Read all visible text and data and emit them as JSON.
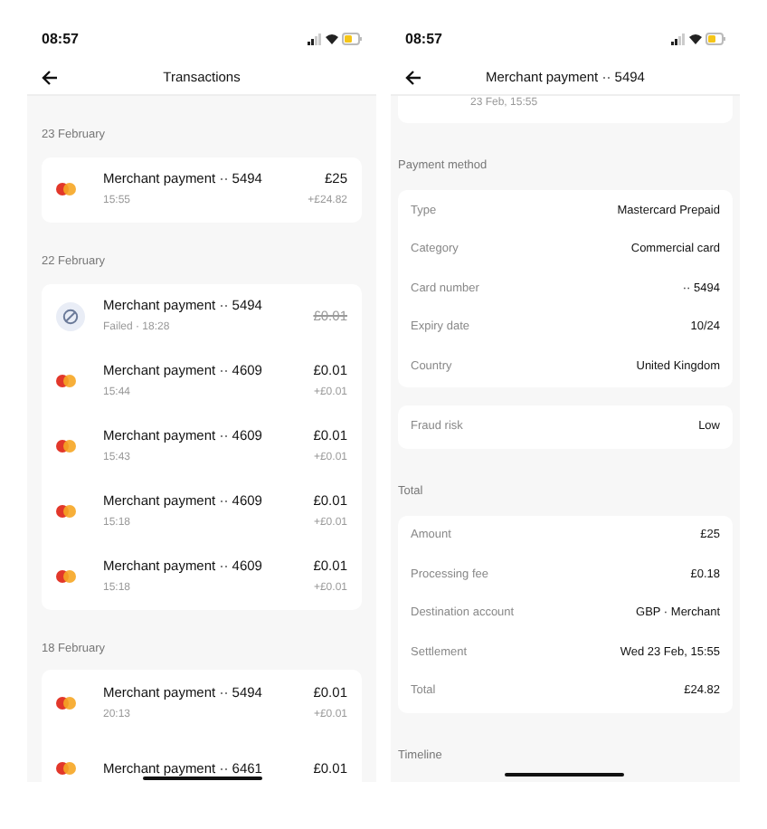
{
  "transactions_screen": {
    "status_bar": {
      "time": "08:57"
    },
    "header": {
      "title": "Transactions"
    },
    "groups": [
      {
        "date": "23 February",
        "rows": [
          {
            "failed": false,
            "title": "Merchant payment ·· 5494",
            "subtitle": "15:55",
            "amount": "£25",
            "net": "+£24.82"
          }
        ]
      },
      {
        "date": "22 February",
        "rows": [
          {
            "failed": true,
            "title": "Merchant payment ·· 5494",
            "subtitle": "Failed · 18:28",
            "amount": "£0.01"
          },
          {
            "failed": false,
            "title": "Merchant payment ·· 4609",
            "subtitle": "15:44",
            "amount": "£0.01",
            "net": "+£0.01"
          },
          {
            "failed": false,
            "title": "Merchant payment ·· 4609",
            "subtitle": "15:43",
            "amount": "£0.01",
            "net": "+£0.01"
          },
          {
            "failed": false,
            "title": "Merchant payment ·· 4609",
            "subtitle": "15:18",
            "amount": "£0.01",
            "net": "+£0.01"
          },
          {
            "failed": false,
            "title": "Merchant payment ·· 4609",
            "subtitle": "15:18",
            "amount": "£0.01",
            "net": "+£0.01"
          }
        ]
      },
      {
        "date": "18 February",
        "rows": [
          {
            "failed": false,
            "title": "Merchant payment ·· 5494",
            "subtitle": "20:13",
            "amount": "£0.01",
            "net": "+£0.01"
          },
          {
            "failed": false,
            "title": "Merchant payment ·· 6461",
            "amount": "£0.01"
          }
        ]
      }
    ]
  },
  "detail_screen": {
    "status_bar": {
      "time": "08:57"
    },
    "header": {
      "title": "Merchant payment ·· 5494"
    },
    "summary_subtitle": "23 Feb, 15:55",
    "sections": [
      {
        "title": "Payment method",
        "cards": [
          {
            "rows": [
              {
                "label": "Type",
                "value": "Mastercard Prepaid"
              },
              {
                "label": "Category",
                "value": "Commercial card"
              },
              {
                "label": "Card number",
                "value": "·· 5494"
              },
              {
                "label": "Expiry date",
                "value": "10/24"
              },
              {
                "label": "Country",
                "value": "United Kingdom"
              }
            ]
          },
          {
            "rows": [
              {
                "label": "Fraud risk",
                "value": "Low"
              }
            ]
          }
        ]
      },
      {
        "title": "Total",
        "cards": [
          {
            "rows": [
              {
                "label": "Amount",
                "value": "£25"
              },
              {
                "label": "Processing fee",
                "value": "£0.18"
              },
              {
                "label": "Destination account",
                "value": "GBP · Merchant"
              },
              {
                "label": "Settlement",
                "value": "Wed 23 Feb, 15:55"
              },
              {
                "label": "Total",
                "value": "£24.82"
              }
            ]
          }
        ]
      },
      {
        "title": "Timeline"
      }
    ]
  }
}
